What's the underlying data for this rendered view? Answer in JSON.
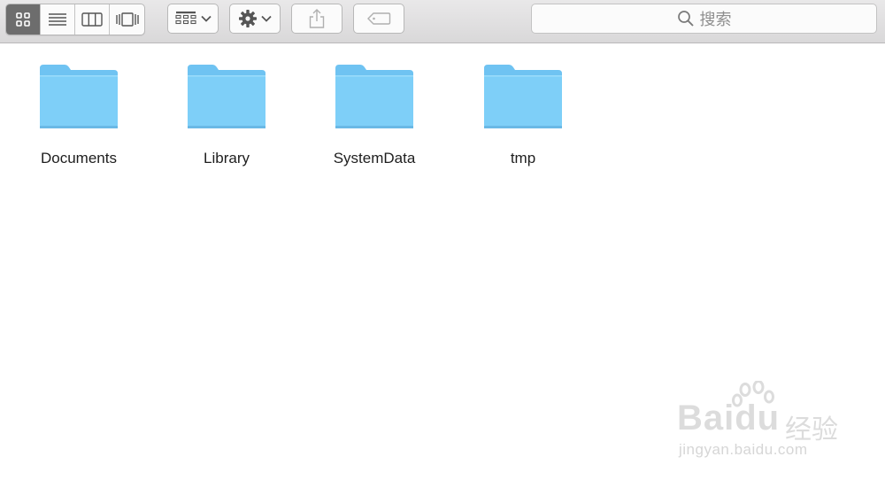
{
  "toolbar": {
    "view_modes": [
      {
        "icon": "icon-view-icon",
        "active": true
      },
      {
        "icon": "list-view-icon",
        "active": false
      },
      {
        "icon": "column-view-icon",
        "active": false
      },
      {
        "icon": "cover-flow-icon",
        "active": false
      }
    ],
    "arrange_icon": "arrange-grid-icon",
    "action_icon": "gear-icon",
    "share_icon": "share-icon",
    "tag_icon": "tag-icon",
    "search": {
      "placeholder": "搜索",
      "icon": "search-icon"
    }
  },
  "folders": [
    {
      "label": "Documents"
    },
    {
      "label": "Library"
    },
    {
      "label": "SystemData"
    },
    {
      "label": "tmp"
    }
  ],
  "watermark": {
    "brand": "Bai",
    "brand_tail": "du",
    "cn": "经验",
    "url": "jingyan.baidu.com"
  },
  "colors": {
    "folder_body": "#7ecff8",
    "folder_tab": "#6fc3f2",
    "toolbar_bg": "#e2e1e2",
    "active_segment": "#6d6d6d"
  }
}
